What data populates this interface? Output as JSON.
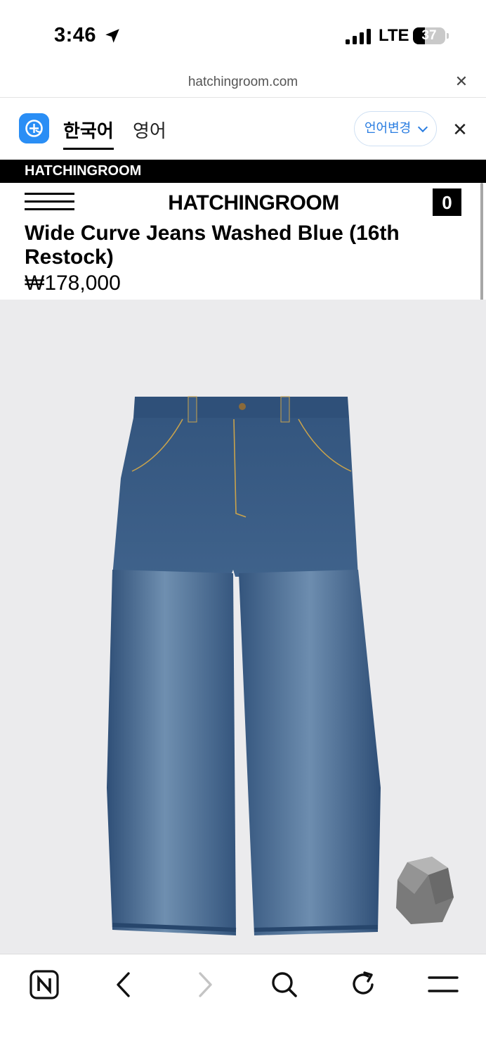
{
  "status_bar": {
    "time": "3:46",
    "network": "LTE",
    "battery_level": "37",
    "battery_fraction": 0.37
  },
  "browser": {
    "url": "hatchingroom.com",
    "close_icon": "close-icon"
  },
  "translate_bar": {
    "source_lang": "한국어",
    "target_lang": "영어",
    "change_language_label": "언어변경",
    "active_tab": "한국어"
  },
  "site": {
    "top_strip": "HATCHINGROOM",
    "logo": "HATCHINGROOM",
    "cart_count": "0"
  },
  "product": {
    "title": "Wide Curve Jeans Washed Blue (16th Restock)",
    "price": "₩178,000"
  },
  "colors": {
    "accent": "#2a8ef5",
    "link_blue": "#2a7de1",
    "image_bg": "#ebebed",
    "denim": "#3d5f86"
  },
  "toolbar": {
    "icons": [
      "naver-icon",
      "back-icon",
      "forward-icon",
      "search-icon",
      "reload-icon",
      "menu-icon"
    ]
  }
}
